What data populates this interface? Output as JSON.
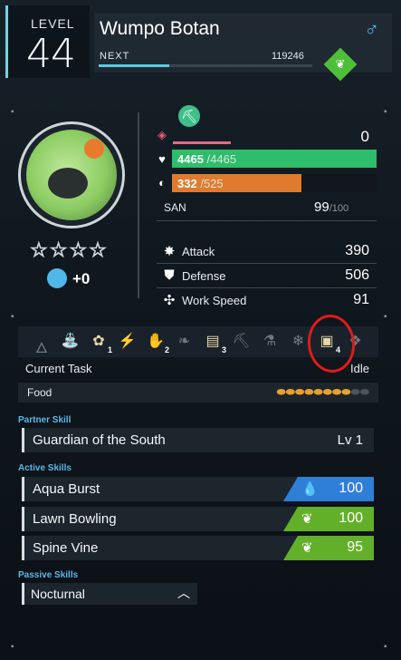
{
  "header": {
    "level_label": "LEVEL",
    "level": "44",
    "name": "Wumpo Botan",
    "gender_icon": "male-symbol-icon",
    "next_label": "NEXT",
    "next_value": "119246",
    "exp_progress": 0.33,
    "element_icon": "leaf-icon"
  },
  "portrait": {
    "stars_filled": 0,
    "stars_total": 4,
    "soul_bonus": "+0"
  },
  "stats": {
    "work_speed_icon": "pickaxe-badge-icon",
    "shield_value": "0",
    "hp_current": "4465",
    "hp_max": "/4465",
    "hp_fraction": 1.0,
    "hunger_current": "332",
    "hunger_max": "/525",
    "hunger_fraction": 0.632,
    "san_label": "SAN",
    "san_current": "99",
    "san_max": "/100",
    "attack_label": "Attack",
    "attack_value": "390",
    "defense_label": "Defense",
    "defense_value": "506",
    "workspeed_label": "Work Speed",
    "workspeed_value": "91",
    "colors": {
      "hp": "#2ebd6b",
      "hunger": "#e07a2e",
      "shield": "#e06a8a"
    }
  },
  "work": {
    "items": [
      {
        "icon": "kindling-icon",
        "level": "",
        "active": false
      },
      {
        "icon": "watering-icon",
        "level": "",
        "active": false
      },
      {
        "icon": "planting-icon",
        "level": "1",
        "active": true
      },
      {
        "icon": "electricity-icon",
        "level": "",
        "active": false
      },
      {
        "icon": "handiwork-icon",
        "level": "2",
        "active": true
      },
      {
        "icon": "gathering-icon",
        "level": "",
        "active": false
      },
      {
        "icon": "lumbering-icon",
        "level": "3",
        "active": true
      },
      {
        "icon": "mining-icon",
        "level": "",
        "active": false
      },
      {
        "icon": "medicine-icon",
        "level": "",
        "active": false
      },
      {
        "icon": "cooling-icon",
        "level": "",
        "active": false
      },
      {
        "icon": "transporting-icon",
        "level": "4",
        "active": true
      },
      {
        "icon": "farming-icon",
        "level": "",
        "active": false
      }
    ],
    "current_task_label": "Current Task",
    "current_task_value": "Idle",
    "food_label": "Food",
    "food_filled": 8,
    "food_total": 10
  },
  "skills": {
    "partner_title": "Partner Skill",
    "partner_name": "Guardian of the South",
    "partner_level": "Lv 1",
    "active_title": "Active Skills",
    "active": [
      {
        "name": "Aqua Burst",
        "power": "100",
        "element": "water-drop-icon",
        "color": "#2f7fd6"
      },
      {
        "name": "Lawn Bowling",
        "power": "100",
        "element": "leaf-icon",
        "color": "#62b02a"
      },
      {
        "name": "Spine Vine",
        "power": "95",
        "element": "leaf-icon",
        "color": "#62b02a"
      }
    ],
    "passive_title": "Passive Skills",
    "passive": [
      {
        "name": "Nocturnal",
        "icon": "chevron-up-icon"
      }
    ]
  }
}
